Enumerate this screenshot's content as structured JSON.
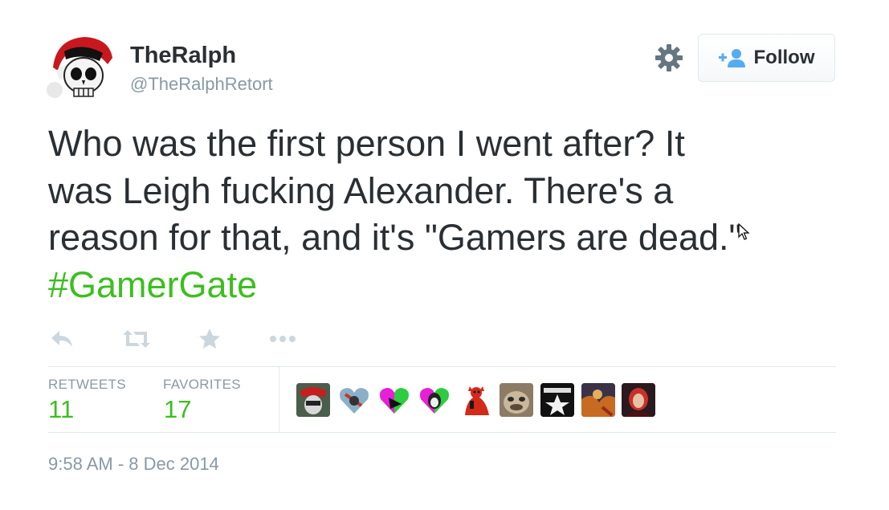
{
  "user": {
    "name": "TheRalph",
    "handle": "@TheRalphRetort"
  },
  "follow_button": {
    "label": "Follow"
  },
  "tweet": {
    "lines": [
      "Who was the first person I went after? It",
      "was Leigh fucking Alexander. There's a",
      "reason for that, and it's \"Gamers are dead.\""
    ],
    "hashtag": "#GamerGate"
  },
  "actions": [
    "reply-icon",
    "retweet-icon",
    "favorite-icon",
    "more-icon"
  ],
  "stats": {
    "retweets": {
      "label": "RETWEETS",
      "value": "11"
    },
    "favorites": {
      "label": "FAVORITES",
      "value": "17"
    }
  },
  "timestamp": "9:58 AM - 8 Dec 2014",
  "colors": {
    "hashtag": "#3bbf1e",
    "muted": "#8899a6",
    "text": "#292f33",
    "border": "#e1e8ed",
    "icon": "#ccd6dd"
  }
}
